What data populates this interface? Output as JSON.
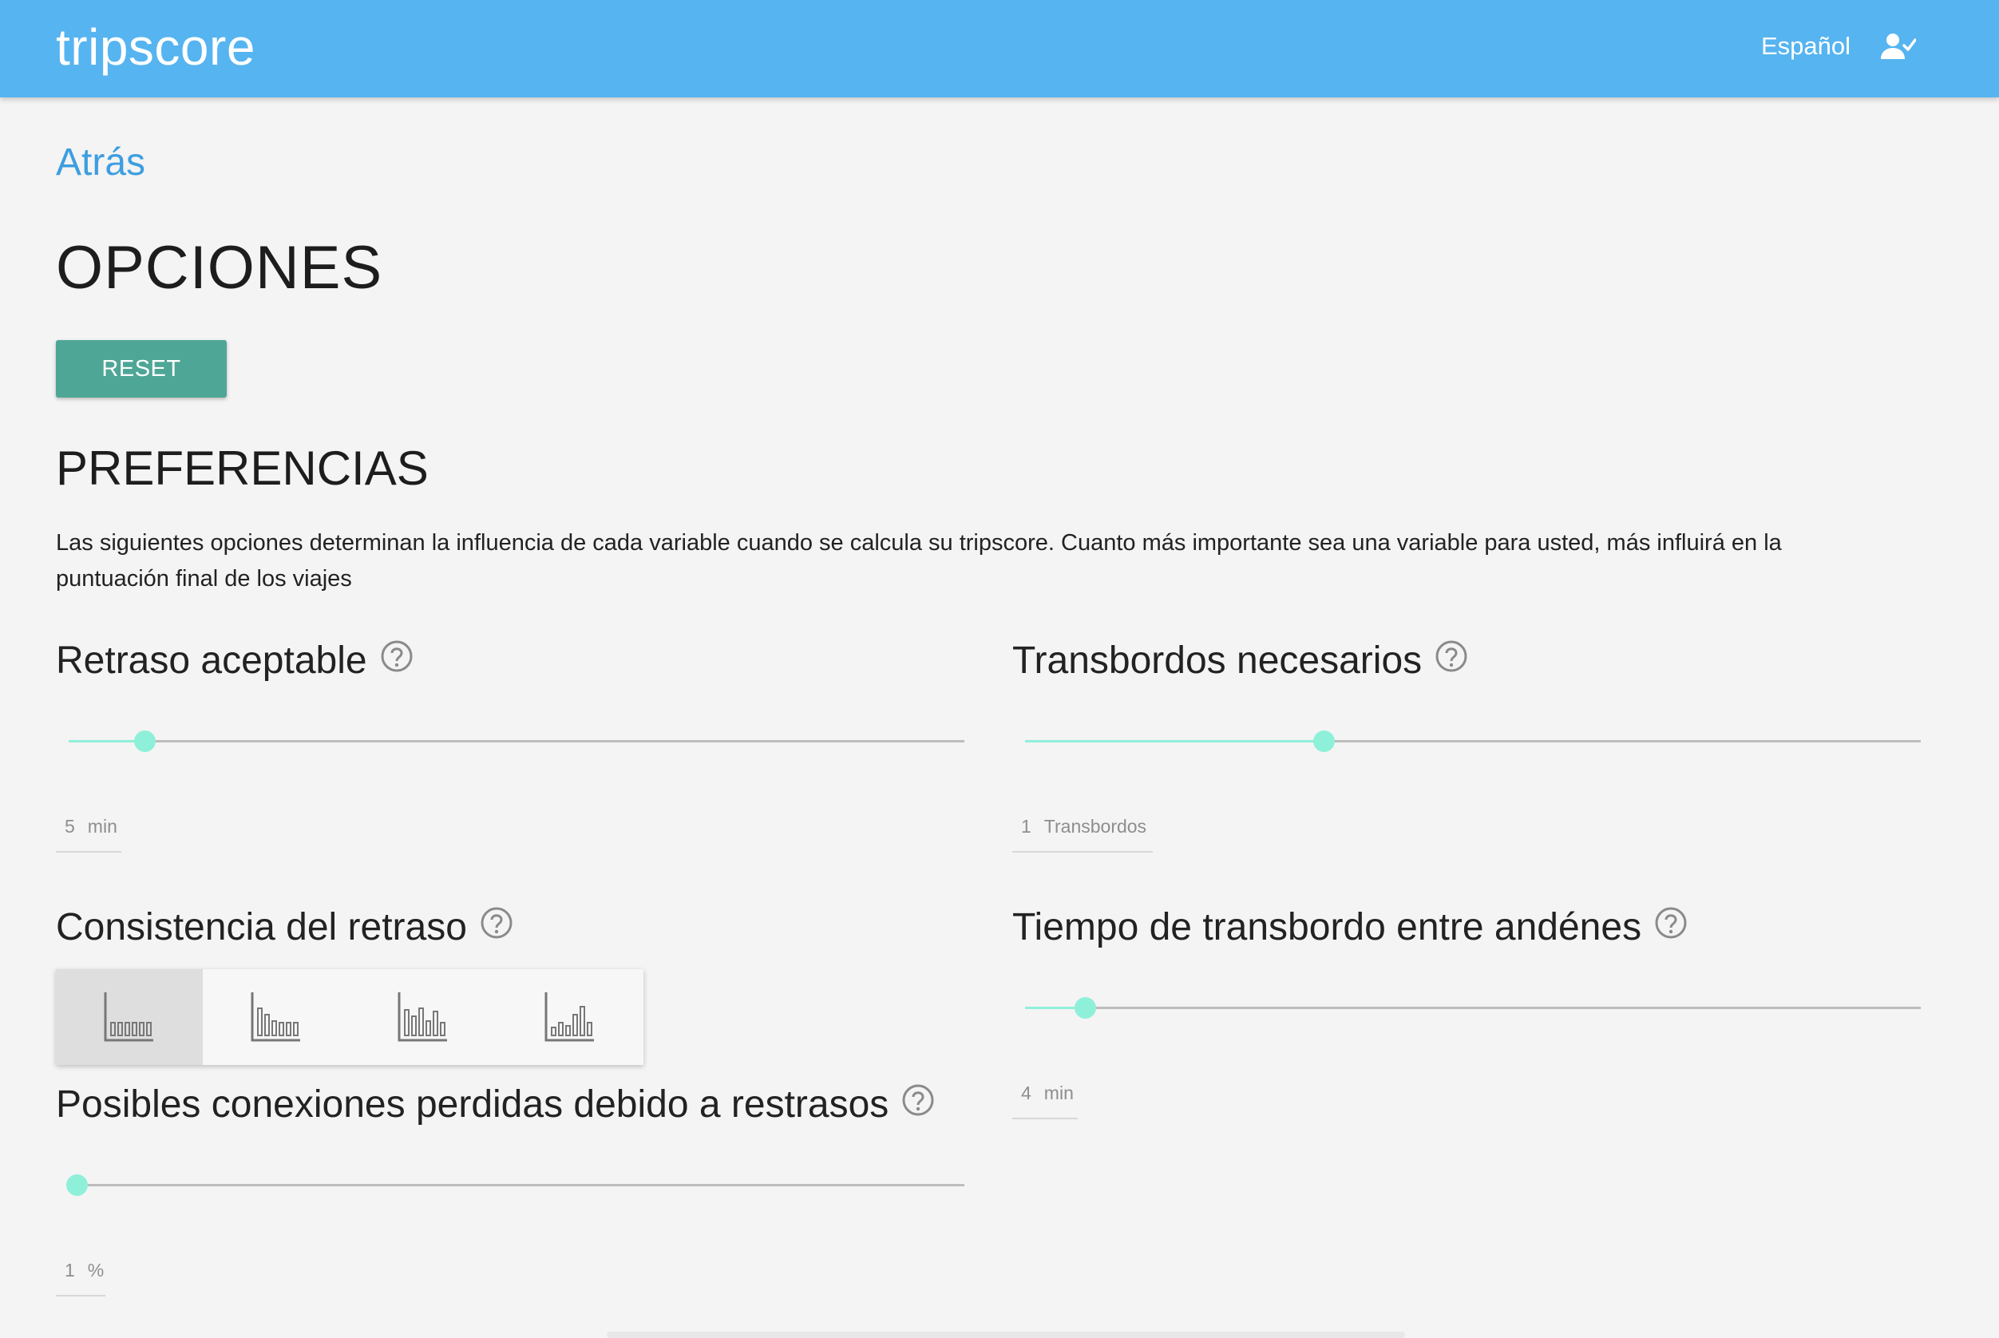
{
  "header": {
    "logo": "tripscore",
    "language": "Español",
    "user_icon": "person-check-icon",
    "brand_color": "#56b4f0"
  },
  "nav": {
    "back": "Atrás"
  },
  "page": {
    "title": "OPCIONES",
    "reset_label": "RESET"
  },
  "preferences": {
    "title": "PREFERENCIAS",
    "description": "Las siguientes opciones determinan la influencia de cada variable cuando se calcula su tripscore. Cuanto más importante sea una variable para usted, más influirá en la puntuación final de los viajes"
  },
  "settings": {
    "delay": {
      "title": "Retraso aceptable",
      "value": "5",
      "unit": "min",
      "slider_fraction": 0.085
    },
    "transfers": {
      "title": "Transbordos necesarios",
      "value": "1",
      "unit": "Transbordos",
      "slider_fraction": 0.333
    },
    "consistency": {
      "title": "Consistencia del retraso",
      "options": [
        "distribution-flat-icon",
        "distribution-decreasing-icon",
        "distribution-middle-icon",
        "distribution-increasing-icon"
      ],
      "selected_index": 0
    },
    "transfer_time": {
      "title": "Tiempo de transbordo entre andénes",
      "value": "4",
      "unit": "min",
      "slider_fraction": 0.067
    },
    "missed": {
      "title": "Posibles conexiones perdidas debido a restrasos",
      "value": "1",
      "unit": "%",
      "slider_fraction": 0.0
    }
  },
  "colors": {
    "accent": "#8ff0d9",
    "button": "#4ea696",
    "link": "#3d9ee0"
  }
}
